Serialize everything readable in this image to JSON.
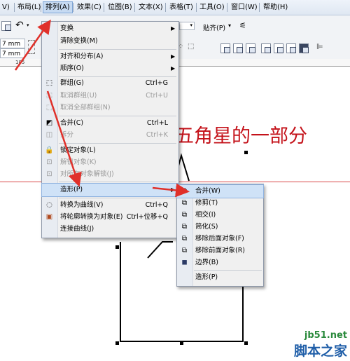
{
  "menubar": {
    "items": [
      {
        "label": "V)"
      },
      {
        "label": "布局(L)"
      },
      {
        "label": "排列(A)"
      },
      {
        "label": "效果(C)"
      },
      {
        "label": "位图(B)"
      },
      {
        "label": "文本(X)"
      },
      {
        "label": "表格(T)"
      },
      {
        "label": "工具(O)"
      },
      {
        "label": "窗口(W)"
      },
      {
        "label": "帮助(H)"
      }
    ],
    "active_index": 2
  },
  "toolbar": {
    "field1_value": "7 mm",
    "field2_value": "7 mm",
    "snap_label": "贴齐(P)",
    "ruler_number": "105"
  },
  "arrange_menu": {
    "items": [
      {
        "label": "变换",
        "shortcut": "",
        "submenu": true,
        "disabled": false,
        "icon": ""
      },
      {
        "label": "清除变换(M)",
        "shortcut": "",
        "submenu": false,
        "disabled": false,
        "icon": ""
      },
      {
        "label": "对齐和分布(A)",
        "shortcut": "",
        "submenu": true,
        "disabled": false,
        "icon": ""
      },
      {
        "label": "顺序(O)",
        "shortcut": "",
        "submenu": true,
        "disabled": false,
        "icon": ""
      },
      {
        "label": "群组(G)",
        "shortcut": "Ctrl+G",
        "submenu": false,
        "disabled": false,
        "icon": "group-icon"
      },
      {
        "label": "取消群组(U)",
        "shortcut": "Ctrl+U",
        "submenu": false,
        "disabled": true,
        "icon": "ungroup-icon"
      },
      {
        "label": "取消全部群组(N)",
        "shortcut": "",
        "submenu": false,
        "disabled": true,
        "icon": "ungroup-all-icon"
      },
      {
        "label": "合并(C)",
        "shortcut": "Ctrl+L",
        "submenu": false,
        "disabled": false,
        "icon": "combine-icon"
      },
      {
        "label": "拆分",
        "shortcut": "Ctrl+K",
        "submenu": false,
        "disabled": true,
        "icon": "break-apart-icon"
      },
      {
        "label": "锁定对象(L)",
        "shortcut": "",
        "submenu": false,
        "disabled": false,
        "icon": "lock-icon"
      },
      {
        "label": "解锁对象(K)",
        "shortcut": "",
        "submenu": false,
        "disabled": true,
        "icon": "unlock-icon"
      },
      {
        "label": "对所有对象解锁(J)",
        "shortcut": "",
        "submenu": false,
        "disabled": true,
        "icon": "unlock-all-icon"
      },
      {
        "label": "造形(P)",
        "shortcut": "",
        "submenu": true,
        "disabled": false,
        "icon": "",
        "highlighted": true
      },
      {
        "label": "转换为曲线(V)",
        "shortcut": "Ctrl+Q",
        "submenu": false,
        "disabled": false,
        "icon": "convert-curves-icon"
      },
      {
        "label": "将轮廓转换为对象(E)",
        "shortcut": "Ctrl+位移+Q",
        "submenu": false,
        "disabled": false,
        "icon": "outline-to-object-icon"
      },
      {
        "label": "连接曲线(J)",
        "shortcut": "",
        "submenu": false,
        "disabled": false,
        "icon": ""
      }
    ]
  },
  "shaping_menu": {
    "items": [
      {
        "label": "合并(W)",
        "highlighted": true
      },
      {
        "label": "修剪(T)"
      },
      {
        "label": "相交(I)"
      },
      {
        "label": "简化(S)"
      },
      {
        "label": "移除后面对象(F)"
      },
      {
        "label": "移除前面对象(R)"
      },
      {
        "label": "边界(B)"
      },
      {
        "label": "造形(P)"
      }
    ]
  },
  "canvas": {
    "red_text": "五角星的一部分"
  },
  "watermark": {
    "line1": "jb51.net",
    "line2": "脚本之家"
  },
  "colors": {
    "accent_red": "#c4121a",
    "menu_highlight": "#cfe2f7",
    "watermark_green": "#2a8a3c",
    "watermark_blue": "#1f5ea8"
  }
}
